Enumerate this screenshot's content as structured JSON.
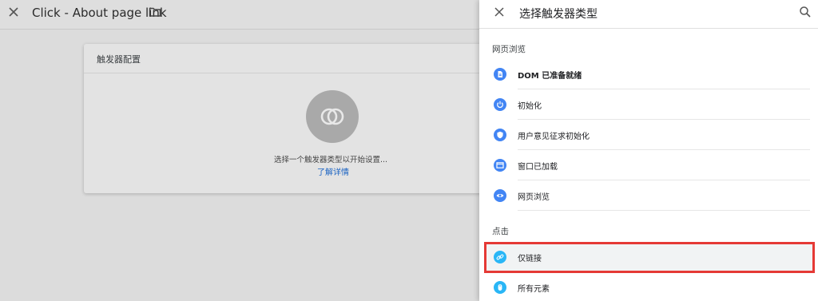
{
  "editor": {
    "title": "Click - About page link",
    "card": {
      "title": "触发器配置",
      "empty_text": "选择一个触发器类型以开始设置...",
      "learn_more": "了解详情"
    }
  },
  "panel": {
    "title": "选择触发器类型",
    "sections": [
      {
        "label": "网页浏览",
        "items": [
          {
            "label": "DOM 已准备就绪",
            "icon": "document-icon"
          },
          {
            "label": "初始化",
            "icon": "power-icon"
          },
          {
            "label": "用户意见征求初始化",
            "icon": "shield-icon"
          },
          {
            "label": "窗口已加载",
            "icon": "window-icon"
          },
          {
            "label": "网页浏览",
            "icon": "eye-icon"
          }
        ]
      },
      {
        "label": "点击",
        "items": [
          {
            "label": "仅链接",
            "icon": "link-icon",
            "selected": true
          },
          {
            "label": "所有元素",
            "icon": "mouse-icon"
          }
        ]
      }
    ]
  },
  "colors": {
    "primary_icon": "#4285f4",
    "click_icon": "#29b6f6",
    "highlight": "#e53935",
    "link": "#1a62c2"
  }
}
